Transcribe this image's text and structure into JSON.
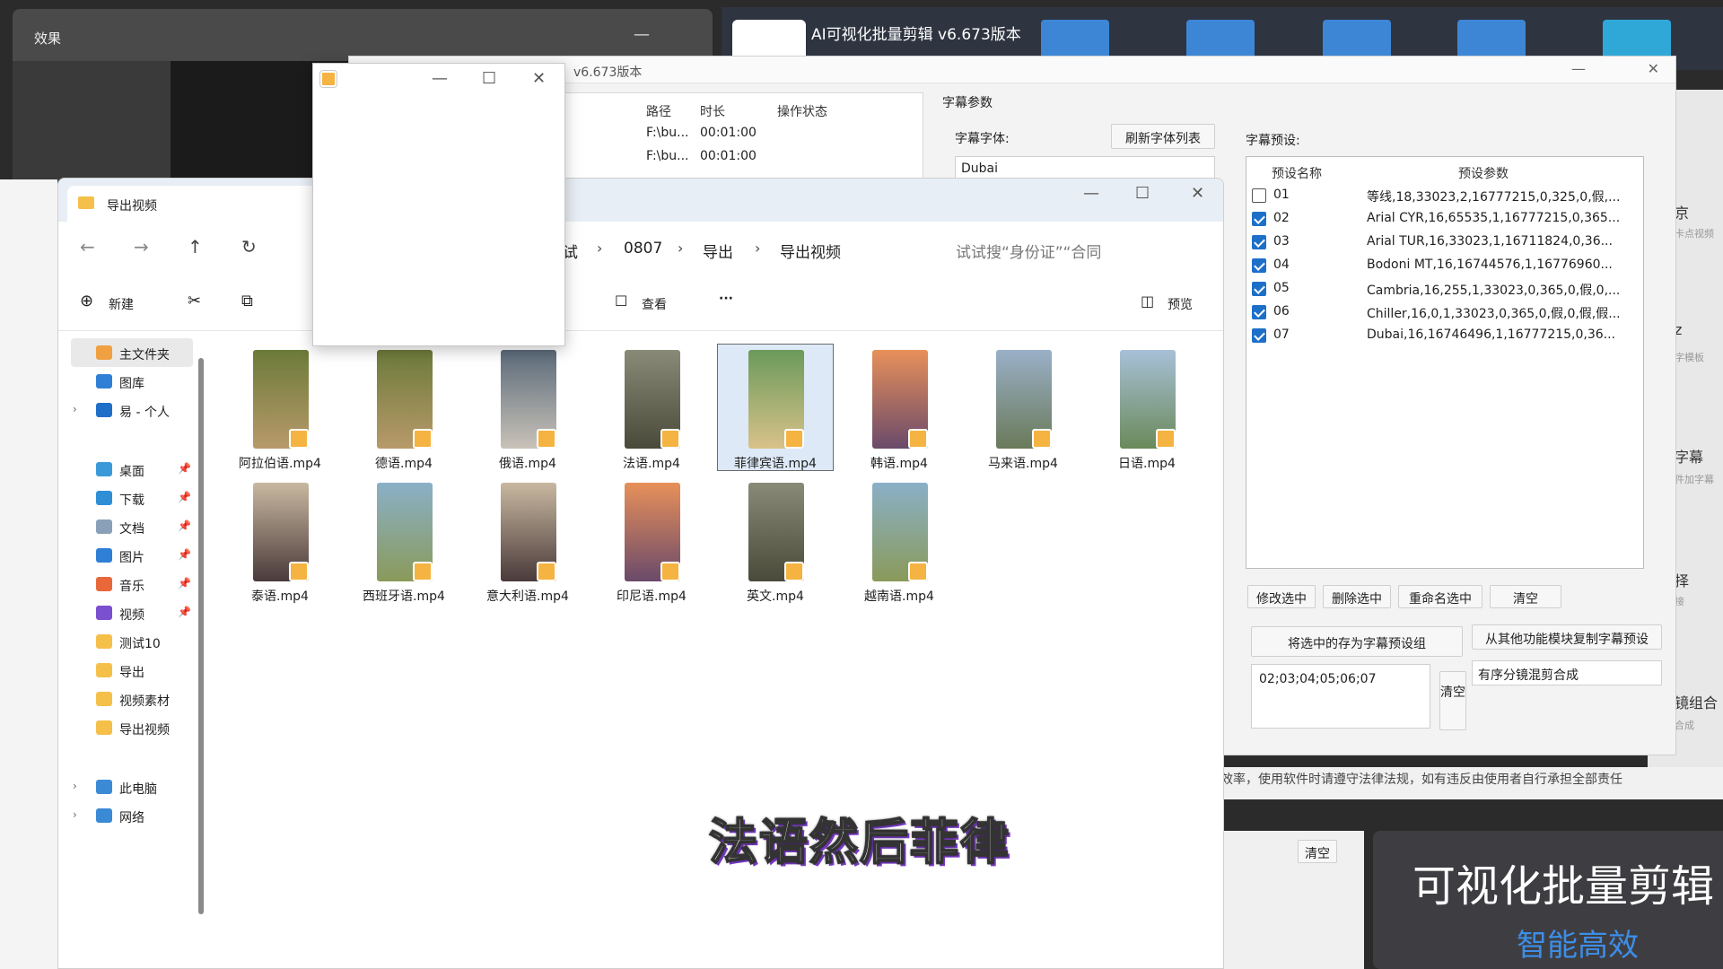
{
  "effects_window": {
    "title": "效果",
    "min": "—"
  },
  "ai_app": {
    "title": "AI可视化批量剪辑 v6.673版本"
  },
  "main_window": {
    "version": "v6.673版本",
    "min": "—",
    "close": "✕",
    "table": {
      "headers": [
        "路径",
        "时长",
        "操作状态"
      ],
      "rows": [
        [
          "F:\\bu...",
          "00:01:00"
        ],
        [
          "F:\\bu...",
          "00:01:00"
        ]
      ]
    }
  },
  "subtitle_panel": {
    "section": "字幕参数",
    "font_label": "字幕字体:",
    "refresh_btn": "刷新字体列表",
    "font_value": "Dubai",
    "preset_label": "字幕预设:",
    "preset_headers": [
      "预设名称",
      "预设参数"
    ],
    "presets": [
      {
        "name": "01",
        "value": "等线,18,33023,2,16777215,0,325,0,假,...",
        "checked": false
      },
      {
        "name": "02",
        "value": "Arial CYR,16,65535,1,16777215,0,365...",
        "checked": true
      },
      {
        "name": "03",
        "value": "Arial TUR,16,33023,1,16711824,0,36...",
        "checked": true
      },
      {
        "name": "04",
        "value": "Bodoni MT,16,16744576,1,16776960...",
        "checked": true
      },
      {
        "name": "05",
        "value": "Cambria,16,255,1,33023,0,365,0,假,0,...",
        "checked": true
      },
      {
        "name": "06",
        "value": "Chiller,16,0,1,33023,0,365,0,假,0,假,假...",
        "checked": true
      },
      {
        "name": "07",
        "value": "Dubai,16,16746496,1,16777215,0,36...",
        "checked": true
      }
    ],
    "buttons": {
      "modify": "修改选中",
      "delete": "删除选中",
      "rename": "重命名选中",
      "clear": "清空"
    },
    "save_group": "将选中的存为字幕预设组",
    "copy_from": "从其他功能模块复制字幕预设",
    "group_value": "02;03;04;05;06;07",
    "clear_v": "清空",
    "mode": "有序分镜混剪合成"
  },
  "right_strip": {
    "l1": "京",
    "l1s": "卡点视频",
    "l2": "z",
    "l2s": "字模板",
    "l3": "字幕",
    "l3s": "件加字幕",
    "l4": "择",
    "l4s": "接",
    "l5": "镜组合",
    "l5s": "合成"
  },
  "warning": "效率，使用软件时请遵守法律法规，如有违反由使用者自行承担全部责任",
  "bottom_clear": "清空",
  "brand": {
    "line1": "可视化批量剪辑",
    "line2": "智能高效"
  },
  "explorer": {
    "tab_title": "导出视频",
    "breadcrumb": [
      "试",
      "0807",
      "导出",
      "导出视频"
    ],
    "search": "试试搜“身份证”“合同",
    "toolbar": {
      "new": "新建",
      "view": "查看",
      "more": "···",
      "preview": "预览"
    },
    "sidebar": [
      {
        "label": "主文件夹",
        "icon": "home-icon",
        "color": "#f0a040"
      },
      {
        "label": "图库",
        "icon": "gallery-icon",
        "color": "#2f7fd6"
      },
      {
        "label": "易 - 个人",
        "icon": "cloud-icon",
        "color": "#1f6fc8"
      },
      {
        "label": "桌面",
        "icon": "desktop-icon",
        "color": "#3a9ad9"
      },
      {
        "label": "下载",
        "icon": "download-icon",
        "color": "#2f8fd6"
      },
      {
        "label": "文档",
        "icon": "document-icon",
        "color": "#8aa0b8"
      },
      {
        "label": "图片",
        "icon": "pictures-icon",
        "color": "#2f7fd6"
      },
      {
        "label": "音乐",
        "icon": "music-icon",
        "color": "#e8683a"
      },
      {
        "label": "视频",
        "icon": "video-icon",
        "color": "#7a4fd0"
      },
      {
        "label": "测试10",
        "icon": "folder-icon",
        "color": "#f5c04a"
      },
      {
        "label": "导出",
        "icon": "folder-icon",
        "color": "#f5c04a"
      },
      {
        "label": "视频素材",
        "icon": "folder-icon",
        "color": "#f5c04a"
      },
      {
        "label": "导出视频",
        "icon": "folder-icon",
        "color": "#f5c04a"
      },
      {
        "label": "此电脑",
        "icon": "computer-icon",
        "color": "#3a8ad6"
      },
      {
        "label": "网络",
        "icon": "network-icon",
        "color": "#3a8ad6"
      }
    ],
    "files": [
      {
        "name": "阿拉伯语.mp4",
        "c1": "#6b7a3a",
        "c2": "#b89a6a"
      },
      {
        "name": "德语.mp4",
        "c1": "#6b7a3a",
        "c2": "#b89a6a"
      },
      {
        "name": "俄语.mp4",
        "c1": "#5a6a7a",
        "c2": "#c9c2b8"
      },
      {
        "name": "法语.mp4",
        "c1": "#8a8a78",
        "c2": "#4a4a3a"
      },
      {
        "name": "菲律宾语.mp4",
        "c1": "#6a9a5a",
        "c2": "#d8c28a"
      },
      {
        "name": "韩语.mp4",
        "c1": "#e8905a",
        "c2": "#6a4a6a"
      },
      {
        "name": "马来语.mp4",
        "c1": "#9ab0c8",
        "c2": "#6a7a5a"
      },
      {
        "name": "日语.mp4",
        "c1": "#a8c0d8",
        "c2": "#6a8a5a"
      },
      {
        "name": "泰语.mp4",
        "c1": "#c8b8a0",
        "c2": "#4a3a3a"
      },
      {
        "name": "西班牙语.mp4",
        "c1": "#8ab0c8",
        "c2": "#8a9a5a"
      },
      {
        "name": "意大利语.mp4",
        "c1": "#c8b8a0",
        "c2": "#4a3a3a"
      },
      {
        "name": "印尼语.mp4",
        "c1": "#e8905a",
        "c2": "#6a4a6a"
      },
      {
        "name": "英文.mp4",
        "c1": "#8a8a78",
        "c2": "#4a4a3a"
      },
      {
        "name": "越南语.mp4",
        "c1": "#8ab0c8",
        "c2": "#8a9a5a"
      }
    ]
  },
  "caption": "法语然后菲律"
}
